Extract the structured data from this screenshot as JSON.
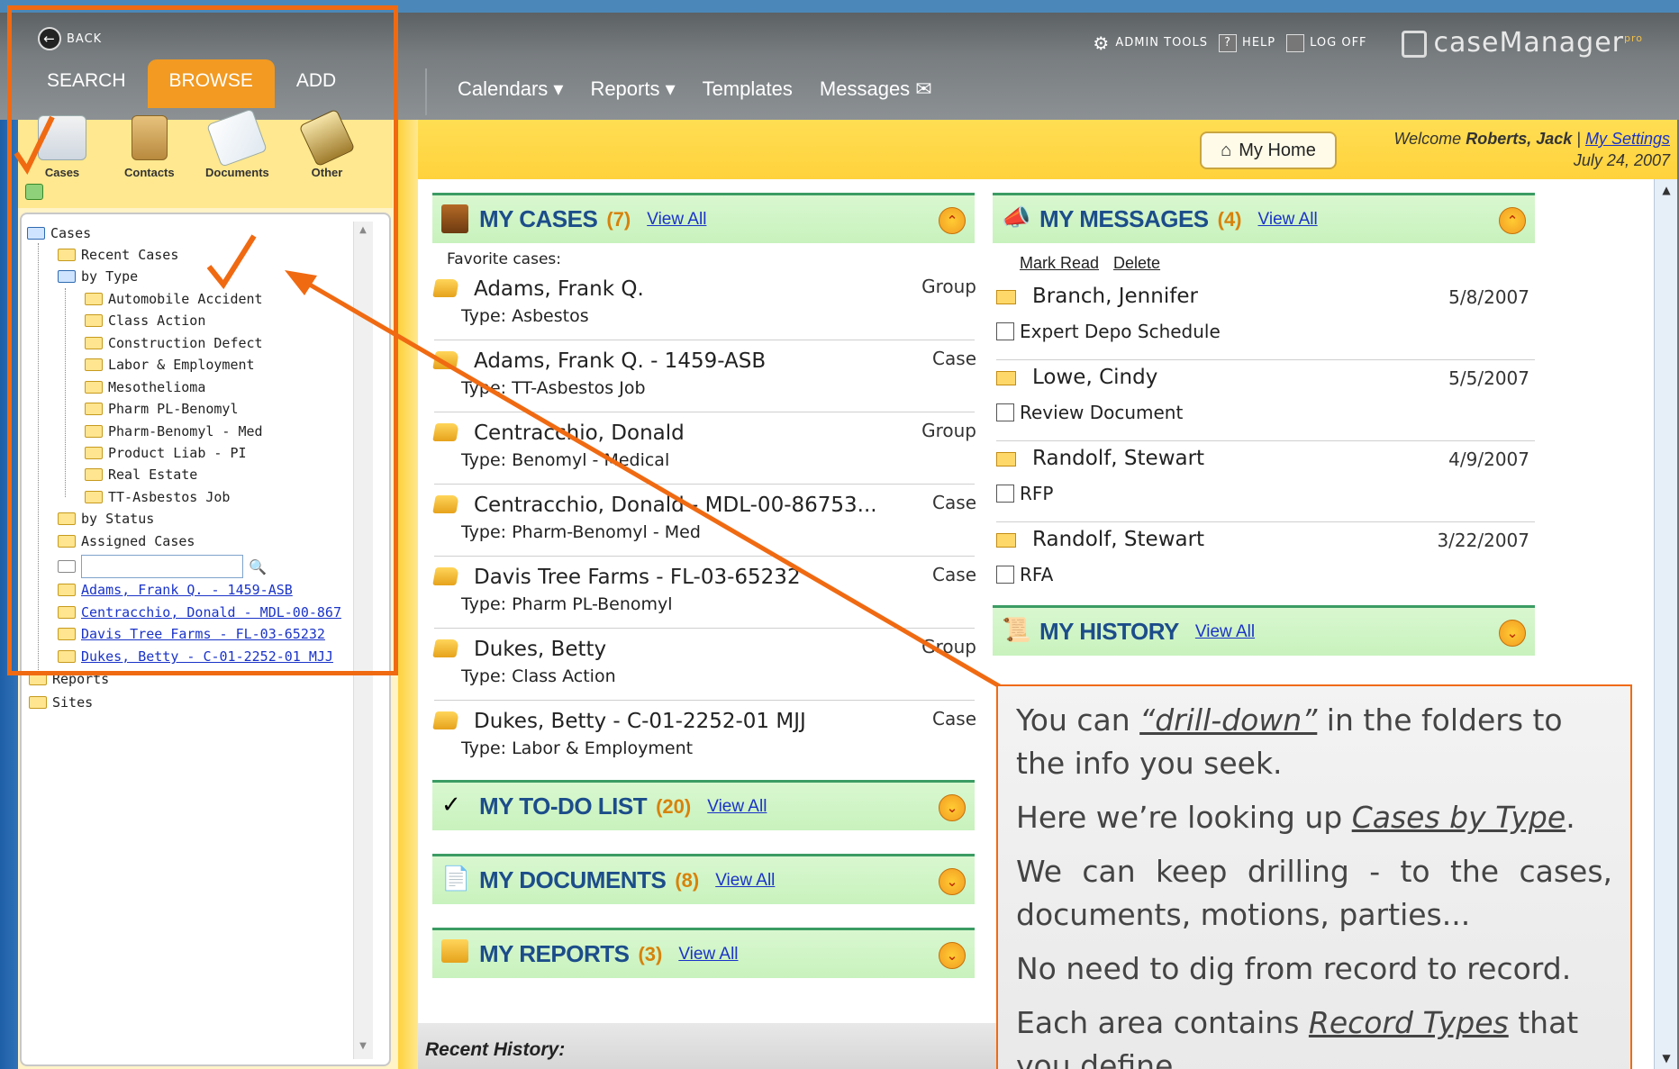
{
  "nav": {
    "back": "BACK",
    "left_tabs": [
      "SEARCH",
      "BROWSE",
      "ADD"
    ],
    "admin_tools": "ADMIN TOOLS",
    "help": "HELP",
    "log_off": "LOG OFF",
    "brand": "caseManager",
    "brand_sup": "pro",
    "main": [
      "Calendars ▾",
      "Reports ▾",
      "Templates",
      "Messages ✉"
    ]
  },
  "browse_icons": [
    "Cases",
    "Contacts",
    "Documents",
    "Other"
  ],
  "tree": {
    "root": "Cases",
    "recent": "Recent Cases",
    "by_type": "by Type",
    "types": [
      "Automobile Accident",
      "Class Action",
      "Construction Defect",
      "Labor & Employment",
      "Mesothelioma",
      "Pharm PL-Benomyl",
      "Pharm-Benomyl - Med",
      "Product Liab - PI",
      "Real Estate",
      "TT-Asbestos Job"
    ],
    "by_status": "by Status",
    "assigned": "Assigned Cases",
    "links": [
      "Adams, Frank Q. - 1459-ASB",
      "Centracchio, Donald - MDL-00-867",
      "Davis Tree Farms - FL-03-65232",
      "Dukes, Betty - C-01-2252-01 MJJ"
    ],
    "reports": "Reports",
    "sites": "Sites"
  },
  "header": {
    "home_button": "My Home",
    "welcome_prefix": "Welcome ",
    "user": "Roberts, Jack",
    "sep": " | ",
    "settings": "My Settings",
    "date": "July 24, 2007"
  },
  "cases": {
    "title": "MY CASES",
    "count": "(7)",
    "view_all": "View All",
    "favorites_label": "Favorite cases:",
    "items": [
      {
        "name": "Adams, Frank Q.",
        "type": "Type: Asbestos",
        "kind": "Group"
      },
      {
        "name": "Adams, Frank Q. - 1459-ASB",
        "type": "Type: TT-Asbestos Job",
        "kind": "Case"
      },
      {
        "name": "Centracchio, Donald",
        "type": "Type: Benomyl - Medical",
        "kind": "Group"
      },
      {
        "name": "Centracchio, Donald - MDL-00-86753...",
        "type": "Type: Pharm-Benomyl - Med",
        "kind": "Case"
      },
      {
        "name": "Davis Tree Farms - FL-03-65232",
        "type": "Type: Pharm PL-Benomyl",
        "kind": "Case"
      },
      {
        "name": "Dukes, Betty",
        "type": "Type: Class Action",
        "kind": "Group"
      },
      {
        "name": "Dukes, Betty - C-01-2252-01 MJJ",
        "type": "Type: Labor & Employment",
        "kind": "Case"
      }
    ]
  },
  "todo": {
    "title": "MY TO-DO LIST",
    "count": "(20)",
    "view_all": "View All"
  },
  "documents": {
    "title": "MY DOCUMENTS",
    "count": "(8)",
    "view_all": "View All"
  },
  "reports": {
    "title": "MY REPORTS",
    "count": "(3)",
    "view_all": "View All"
  },
  "messages": {
    "title": "MY MESSAGES",
    "count": "(4)",
    "view_all": "View All",
    "mark_read": "Mark Read",
    "delete": "Delete",
    "items": [
      {
        "from": "Branch, Jennifer",
        "date": "5/8/2007",
        "subject": "Expert Depo Schedule"
      },
      {
        "from": "Lowe, Cindy",
        "date": "5/5/2007",
        "subject": "Review Document"
      },
      {
        "from": "Randolf, Stewart",
        "date": "4/9/2007",
        "subject": "RFP"
      },
      {
        "from": "Randolf, Stewart",
        "date": "3/22/2007",
        "subject": "RFA"
      }
    ]
  },
  "history": {
    "title": "MY HISTORY",
    "view_all": "View All",
    "recent_label": "Recent History:"
  },
  "callout": {
    "p1_a": "You can ",
    "p1_b": "“drill-down”",
    "p1_c": " in the folders to the info you seek.",
    "p2_a": "Here we’re looking up ",
    "p2_b": "Cases by Type",
    "p2_c": ".",
    "p3": "We can keep drilling - to the cases, documents, motions, parties...",
    "p4": "No need to dig from record to record.",
    "p5_a": "Each area contains ",
    "p5_b": "Record Types",
    "p5_c": " that you define."
  },
  "colors": {
    "accent_orange": "#f06a12",
    "panel_green": "#c8f2bd",
    "link_blue": "#1a33c8"
  }
}
